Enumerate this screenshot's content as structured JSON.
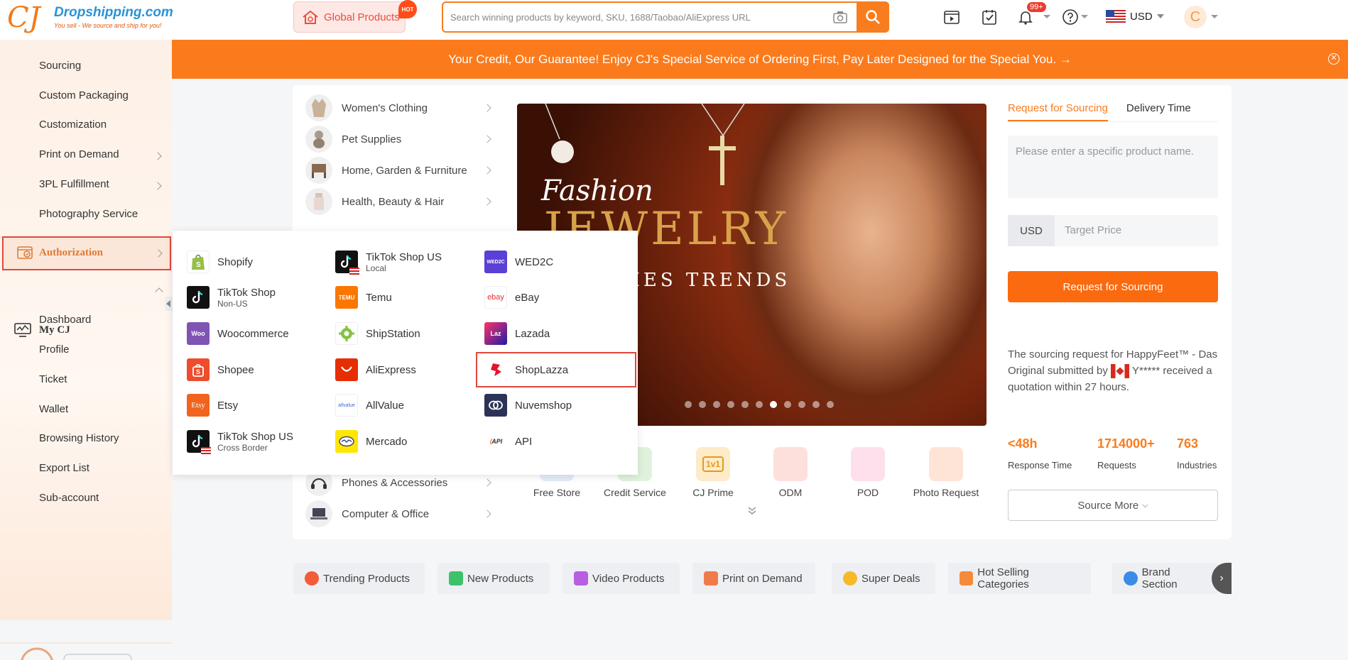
{
  "header": {
    "logo_name": "Dropshipping.com",
    "logo_tagline": "You sell - We source and ship for you!",
    "global_products": "Global Products",
    "hot_badge": "HOT",
    "search_placeholder": "Search winning products by keyword, SKU, 1688/Taobao/AliExpress URL",
    "notif_count": "99+",
    "currency": "USD",
    "avatar_letter": "C"
  },
  "sidebar": {
    "items": [
      "Sourcing",
      "Custom Packaging",
      "Customization",
      "Print on Demand",
      "3PL Fulfillment",
      "Photography Service"
    ],
    "authorization": "Authorization",
    "mycj": "My CJ",
    "mycj_items": [
      "Dashboard",
      "Profile",
      "Ticket",
      "Wallet",
      "Browsing History",
      "Export List",
      "Sub-account"
    ]
  },
  "banner": {
    "text": "Your Credit, Our Guarantee! Enjoy CJ's Special Service of Ordering First, Pay Later Designed for the Special You. →"
  },
  "categories": [
    "Women's Clothing",
    "Pet Supplies",
    "Home, Garden & Furniture",
    "Health, Beauty & Hair",
    "Phones & Accessories",
    "Computer & Office"
  ],
  "hero": {
    "line1": "Fashion",
    "line2": "JEWELRY",
    "line3": "RIES TRENDS",
    "slide_count": 11,
    "active_slide": 6
  },
  "services": [
    "Free Store",
    "Credit Service",
    "CJ Prime",
    "ODM",
    "POD",
    "Photo Request"
  ],
  "sourcing_panel": {
    "tabs": [
      "Request for Sourcing",
      "Delivery Time"
    ],
    "product_placeholder": "Please enter a specific product name.",
    "currency": "USD",
    "price_placeholder": "Target Price",
    "button": "Request for Sourcing",
    "note_pre": "The sourcing request for HappyFeet™ - Das Original submitted by",
    "note_user": "Y*****",
    "note_post": "received a quotation within 27 hours.",
    "stats": [
      {
        "value": "<48h",
        "label": "Response Time"
      },
      {
        "value": "1714000+",
        "label": "Requests"
      },
      {
        "value": "763",
        "label": "Industries"
      }
    ],
    "source_more": "Source More"
  },
  "bottom_tabs": [
    "Trending Products",
    "New Products",
    "Video Products",
    "Print on Demand",
    "Super Deals",
    "Hot Selling Categories",
    "Brand Section"
  ],
  "platforms": {
    "col1": [
      {
        "name": "Shopify",
        "sub": ""
      },
      {
        "name": "TikTok Shop",
        "sub": "Non-US"
      },
      {
        "name": "Woocommerce",
        "sub": ""
      },
      {
        "name": "Shopee",
        "sub": ""
      },
      {
        "name": "Etsy",
        "sub": ""
      },
      {
        "name": "TikTok Shop US",
        "sub": "Cross Border"
      }
    ],
    "col2": [
      {
        "name": "TikTok Shop US",
        "sub": "Local"
      },
      {
        "name": "Temu",
        "sub": ""
      },
      {
        "name": "ShipStation",
        "sub": ""
      },
      {
        "name": "AliExpress",
        "sub": ""
      },
      {
        "name": "AllValue",
        "sub": ""
      },
      {
        "name": "Mercado",
        "sub": ""
      }
    ],
    "col3": [
      {
        "name": "WED2C",
        "sub": ""
      },
      {
        "name": "eBay",
        "sub": ""
      },
      {
        "name": "Lazada",
        "sub": ""
      },
      {
        "name": "ShopLazza",
        "sub": ""
      },
      {
        "name": "Nuvemshop",
        "sub": ""
      },
      {
        "name": "API",
        "sub": ""
      }
    ],
    "logo_texts": {
      "temu": "TEMU",
      "woo": "Woo",
      "etsy": "Etsy",
      "ebay": "ebay",
      "wed2c": "WED2C",
      "allvalue": "allvalue",
      "lazada": "Laz",
      "api": "API"
    }
  },
  "colors": {
    "accent": "#fb7b1c",
    "highlight": "#e2463b",
    "link": "#2a93d5"
  }
}
